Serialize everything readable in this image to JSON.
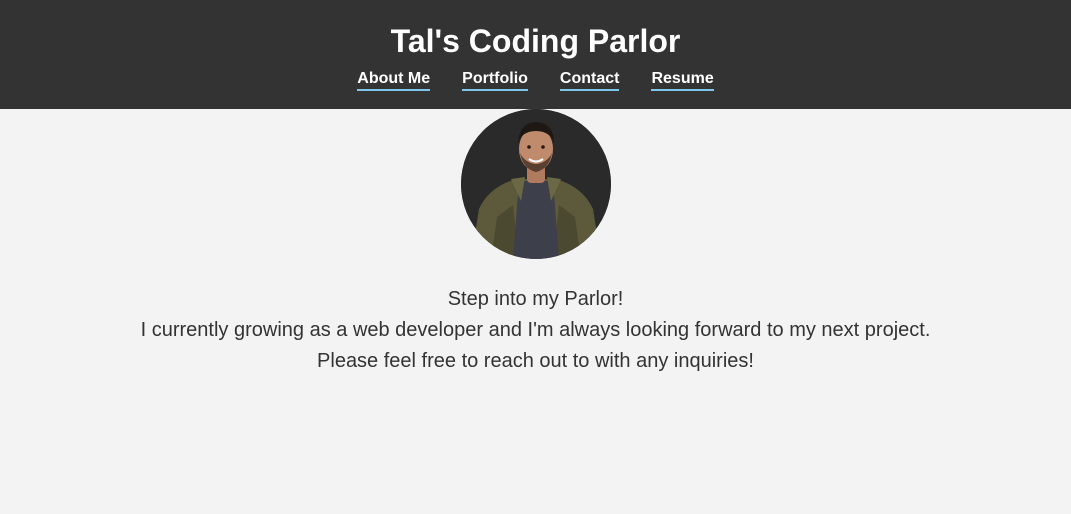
{
  "header": {
    "title": "Tal's Coding Parlor",
    "nav": [
      {
        "label": "About Me"
      },
      {
        "label": "Portfolio"
      },
      {
        "label": "Contact"
      },
      {
        "label": "Resume"
      }
    ]
  },
  "main": {
    "avatar_alt": "profile photo",
    "lines": [
      "Step into my Parlor!",
      "I currently growing as a web developer and I'm always looking forward to my next project.",
      "Please feel free to reach out to with any inquiries!"
    ]
  },
  "colors": {
    "header_bg": "#333333",
    "page_bg": "#f3f3f3",
    "nav_underline": "#7cc7ea",
    "text": "#333333"
  }
}
